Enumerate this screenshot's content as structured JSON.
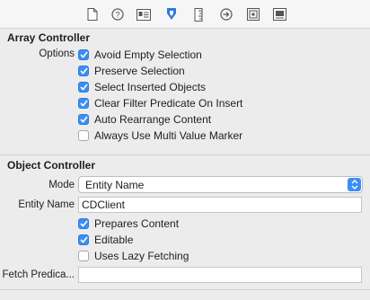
{
  "toolbar": {
    "icons": [
      "file-icon",
      "help-icon",
      "identity-icon",
      "attributes-icon",
      "size-icon",
      "connections-icon",
      "bindings-icon",
      "view-effects-icon"
    ]
  },
  "array_controller": {
    "title": "Array Controller",
    "options_label": "Options",
    "options": [
      {
        "label": "Avoid Empty Selection",
        "checked": true
      },
      {
        "label": "Preserve Selection",
        "checked": true
      },
      {
        "label": "Select Inserted Objects",
        "checked": true
      },
      {
        "label": "Clear Filter Predicate On Insert",
        "checked": true
      },
      {
        "label": "Auto Rearrange Content",
        "checked": true
      },
      {
        "label": "Always Use Multi Value Marker",
        "checked": false
      }
    ]
  },
  "object_controller": {
    "title": "Object Controller",
    "mode_label": "Mode",
    "mode_value": "Entity Name",
    "entity_name_label": "Entity Name",
    "entity_name_value": "CDClient",
    "options": [
      {
        "label": "Prepares Content",
        "checked": true
      },
      {
        "label": "Editable",
        "checked": true
      },
      {
        "label": "Uses Lazy Fetching",
        "checked": false
      }
    ],
    "fetch_predicate_label": "Fetch Predica...",
    "fetch_predicate_value": ""
  },
  "colors": {
    "accent": "#3a8ef5",
    "selected_icon": "#2f7be0",
    "background": "#ececec"
  }
}
